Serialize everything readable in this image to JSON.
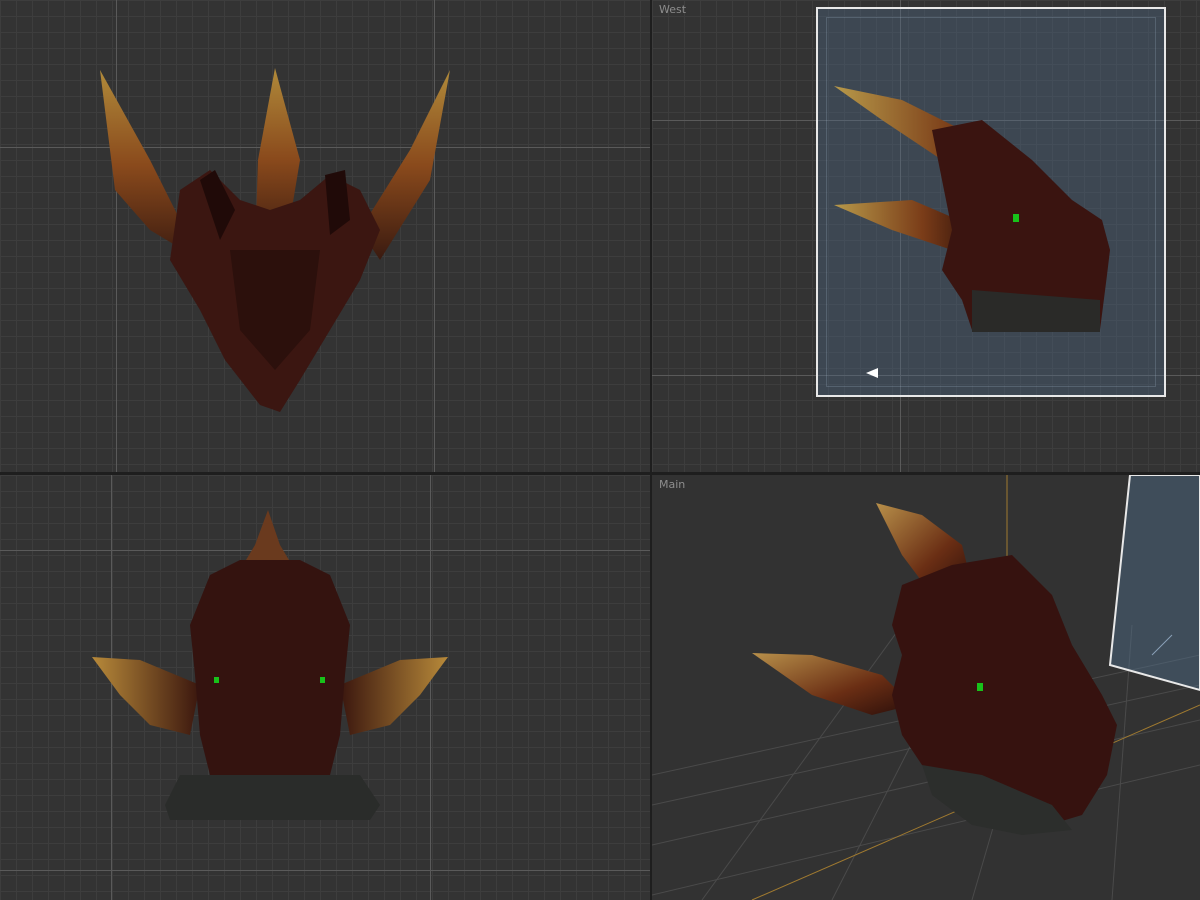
{
  "viewports": {
    "top": {
      "label": ""
    },
    "west": {
      "label": "West"
    },
    "front": {
      "label": ""
    },
    "main": {
      "label": "Main"
    }
  },
  "colors": {
    "background": "#333333",
    "grid": "#3d3d3d",
    "axis": "#5a5a5a",
    "selection_border": "#e8e8e8",
    "selection_fill": "#506e8c",
    "model_dark": "#3a1410",
    "model_horn": "#c88a2a",
    "eye": "#18c21a",
    "main_axis": "#c89a3a"
  },
  "icons": {
    "camera_marker": "camera-direction-icon"
  }
}
